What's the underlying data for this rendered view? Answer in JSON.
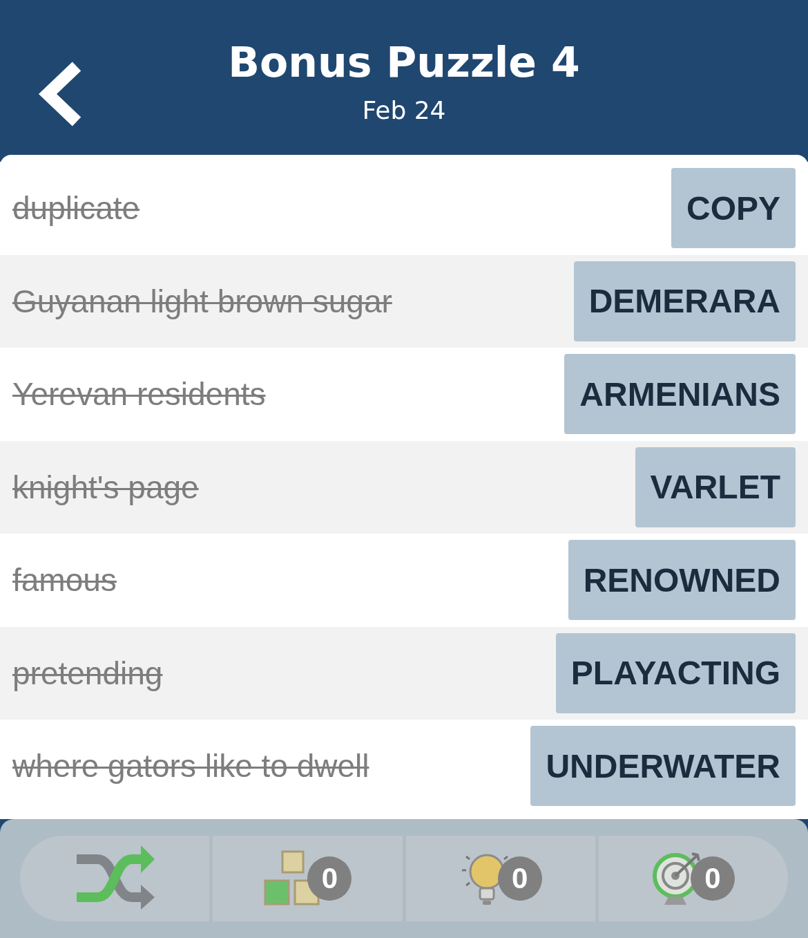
{
  "header": {
    "title": "Bonus Puzzle 4",
    "subtitle": "Feb 24"
  },
  "clues": [
    {
      "clue": "duplicate",
      "answer": "COPY",
      "solved": true
    },
    {
      "clue": "Guyanan light brown sugar",
      "answer": "DEMERARA",
      "solved": true
    },
    {
      "clue": "Yerevan residents",
      "answer": "ARMENIANS",
      "solved": true
    },
    {
      "clue": "knight's page",
      "answer": "VARLET",
      "solved": true
    },
    {
      "clue": "famous",
      "answer": "RENOWNED",
      "solved": true
    },
    {
      "clue": "pretending",
      "answer": "PLAYACTING",
      "solved": true
    },
    {
      "clue": "where gators like to dwell",
      "answer": "UNDERWATER",
      "solved": true
    }
  ],
  "toolbar": [
    {
      "kind": "shuffle"
    },
    {
      "kind": "letters",
      "count": "0"
    },
    {
      "kind": "hint",
      "count": "0"
    },
    {
      "kind": "target",
      "count": "0"
    }
  ]
}
